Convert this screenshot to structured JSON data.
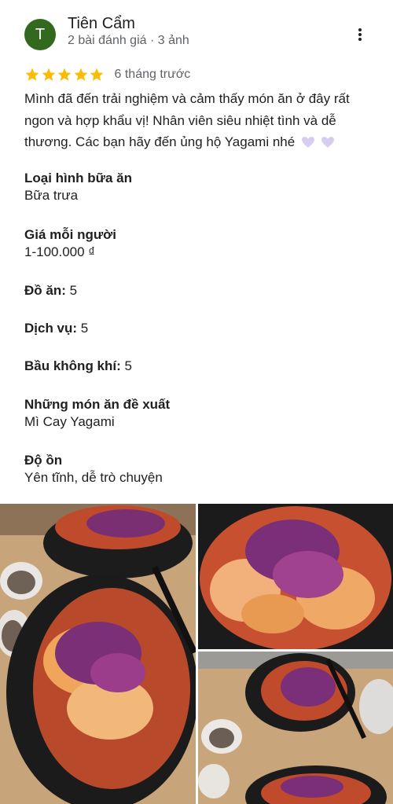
{
  "reviewer": {
    "initial": "T",
    "name": "Tiên Cẩm",
    "meta": "2 bài đánh giá · 3 ảnh",
    "avatar_color": "#33691e"
  },
  "rating": {
    "stars": 5,
    "max": 5,
    "time": "6 tháng trước",
    "star_color": "#fbbc04"
  },
  "review": {
    "text": "Mình đã đến trải nghiệm và cảm thấy món ăn ở đây rất ngon và hợp khẩu vị! Nhân viên siêu nhiệt tình và dễ thương. Các bạn hãy đến ủng hộ Yagami nhé",
    "emoji": "heart-icon"
  },
  "attributes": {
    "meal_type": {
      "label": "Loại hình bữa ăn",
      "value": "Bữa trưa"
    },
    "price": {
      "label": "Giá mỗi người",
      "value": "1-100.000 ₫"
    },
    "food": {
      "label": "Đồ ăn:",
      "value": "5"
    },
    "service": {
      "label": "Dịch vụ:",
      "value": "5"
    },
    "atmosphere": {
      "label": "Bầu không khí:",
      "value": "5"
    },
    "recommended": {
      "label": "Những món ăn đề xuất",
      "value": "Mì Cay Yagami"
    },
    "noise": {
      "label": "Độ ồn",
      "value": "Yên tĩnh, dễ trò chuyện"
    }
  },
  "photos": [
    {
      "name": "review-photo-1"
    },
    {
      "name": "review-photo-2"
    },
    {
      "name": "review-photo-3"
    }
  ],
  "icons": {
    "more": "more-vert-icon",
    "star": "star-icon"
  }
}
